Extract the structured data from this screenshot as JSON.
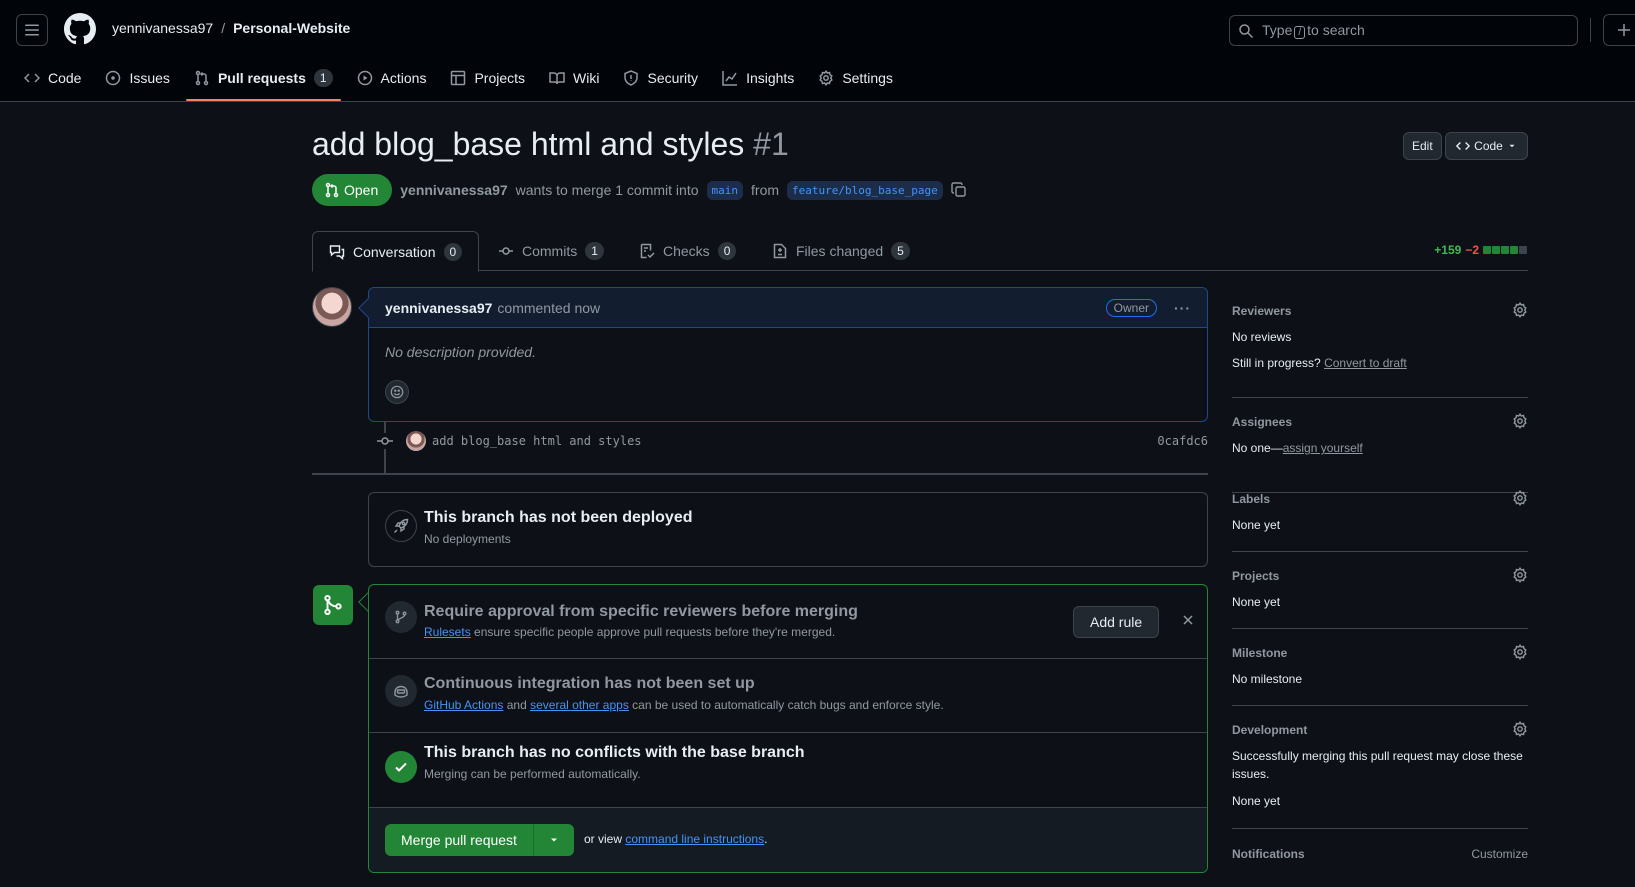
{
  "header": {
    "owner": "yennivanessa97",
    "separator": "/",
    "repo": "Personal-Website",
    "search_prefix": "Type",
    "search_key": "/",
    "search_suffix": "to search"
  },
  "repo_nav": [
    {
      "label": "Code",
      "icon": "code-icon"
    },
    {
      "label": "Issues",
      "icon": "issue-icon"
    },
    {
      "label": "Pull requests",
      "icon": "pull-request-icon",
      "count": "1",
      "active": true
    },
    {
      "label": "Actions",
      "icon": "play-icon"
    },
    {
      "label": "Projects",
      "icon": "table-icon"
    },
    {
      "label": "Wiki",
      "icon": "book-icon"
    },
    {
      "label": "Security",
      "icon": "shield-icon"
    },
    {
      "label": "Insights",
      "icon": "graph-icon"
    },
    {
      "label": "Settings",
      "icon": "gear-icon"
    }
  ],
  "pr": {
    "title": "add blog_base html and styles",
    "number": "#1",
    "edit_label": "Edit",
    "code_label": "Code",
    "state": "Open",
    "author": "yennivanessa97",
    "merge_text": "wants to merge 1 commit into",
    "base_branch": "main",
    "from_text": "from",
    "head_branch": "feature/blog_base_page"
  },
  "tabs": [
    {
      "label": "Conversation",
      "count": "0"
    },
    {
      "label": "Commits",
      "count": "1"
    },
    {
      "label": "Checks",
      "count": "0"
    },
    {
      "label": "Files changed",
      "count": "5"
    }
  ],
  "diffstat": {
    "additions": "+159",
    "deletions": "−2"
  },
  "comment": {
    "author": "yennivanessa97",
    "action": "commented now",
    "badge": "Owner",
    "more": "···",
    "body": "No description provided."
  },
  "commit": {
    "message": "add blog_base html and styles",
    "sha": "0cafdc6"
  },
  "deploy": {
    "title": "This branch has not been deployed",
    "subtitle": "No deployments"
  },
  "merge": {
    "rules_title": "Require approval from specific reviewers before merging",
    "rules_link": "Rulesets",
    "rules_text": "ensure specific people approve pull requests before they're merged.",
    "add_rule": "Add rule",
    "ci_title": "Continuous integration has not been set up",
    "ci_link1": "GitHub Actions",
    "ci_and": "and",
    "ci_link2": "several other apps",
    "ci_text": "can be used to automatically catch bugs and enforce style.",
    "conflict_title": "This branch has no conflicts with the base branch",
    "conflict_sub": "Merging can be performed automatically.",
    "merge_button": "Merge pull request",
    "or_view": "or view",
    "cli_link": "command line instructions",
    "cli_period": "."
  },
  "sidebar": {
    "reviewers": {
      "title": "Reviewers",
      "value": "No reviews",
      "progress": "Still in progress?",
      "link": "Convert to draft"
    },
    "assignees": {
      "title": "Assignees",
      "value": "No one—",
      "link": "assign yourself"
    },
    "labels": {
      "title": "Labels",
      "value": "None yet"
    },
    "projects": {
      "title": "Projects",
      "value": "None yet"
    },
    "milestone": {
      "title": "Milestone",
      "value": "No milestone"
    },
    "development": {
      "title": "Development",
      "text1": "Successfully merging this pull request may close these",
      "text2": "issues.",
      "value": "None yet"
    },
    "notifications": {
      "title": "Notifications",
      "customize": "Customize"
    }
  },
  "colors": {
    "accent_green": "#238636",
    "link_blue": "#4493f8",
    "tab_underline": "#f78166"
  }
}
